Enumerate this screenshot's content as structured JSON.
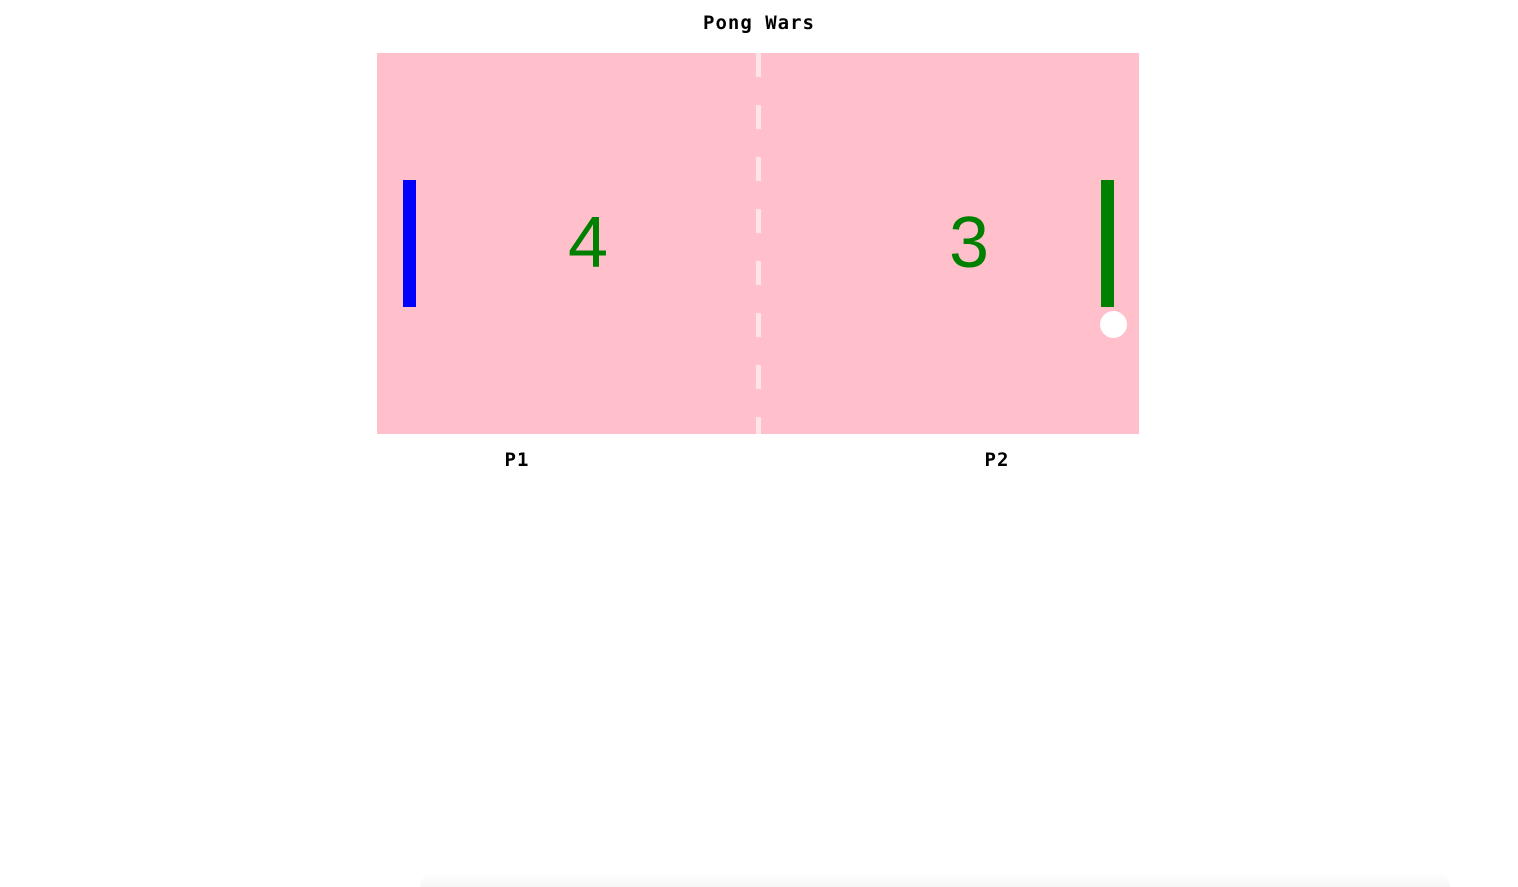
{
  "game": {
    "title": "Pong Wars",
    "colors": {
      "board": "#ffc0cb",
      "net": "#ffe4e8",
      "left_paddle": "#0000ff",
      "right_paddle": "#008000",
      "score": "#008000",
      "ball": "#ffffff"
    },
    "scores": {
      "p1": "4",
      "p2": "3"
    },
    "players": {
      "p1_label": "P1",
      "p2_label": "P2"
    }
  }
}
